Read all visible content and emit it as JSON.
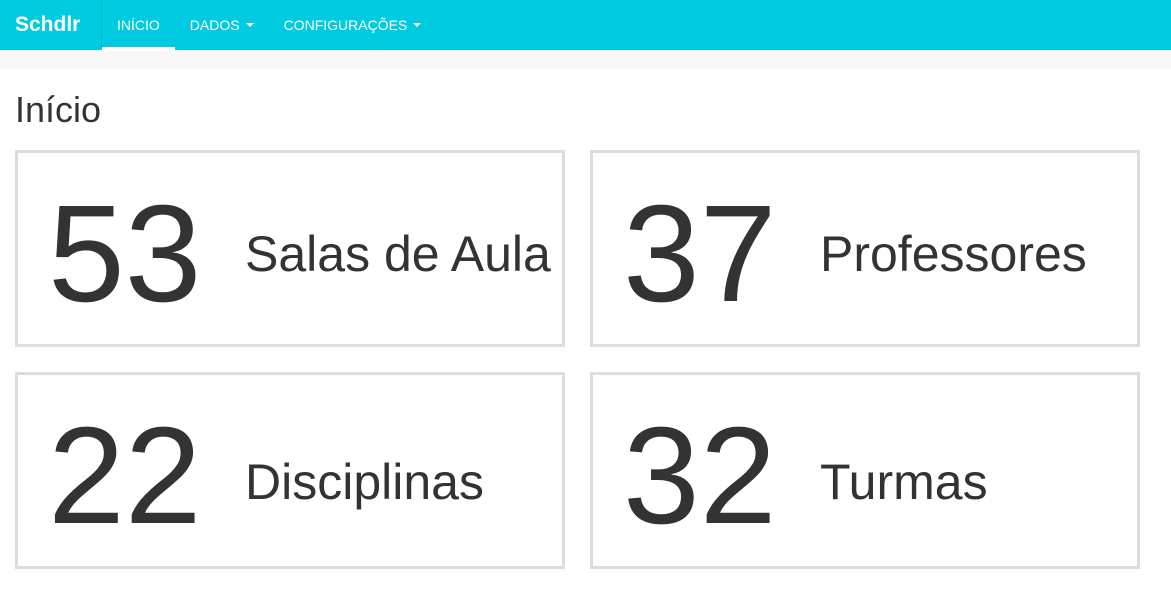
{
  "navbar": {
    "brand": "Schdlr",
    "items": [
      {
        "label": "INÍCIO",
        "active": true,
        "dropdown": false
      },
      {
        "label": "DADOS",
        "active": false,
        "dropdown": true
      },
      {
        "label": "CONFIGURAÇÕES",
        "active": false,
        "dropdown": true
      }
    ],
    "color": "#00cbe0"
  },
  "page": {
    "title": "Início"
  },
  "cards": [
    {
      "value": "53",
      "label": "Salas de Aula"
    },
    {
      "value": "37",
      "label": "Professores"
    },
    {
      "value": "22",
      "label": "Disciplinas"
    },
    {
      "value": "32",
      "label": "Turmas"
    }
  ]
}
